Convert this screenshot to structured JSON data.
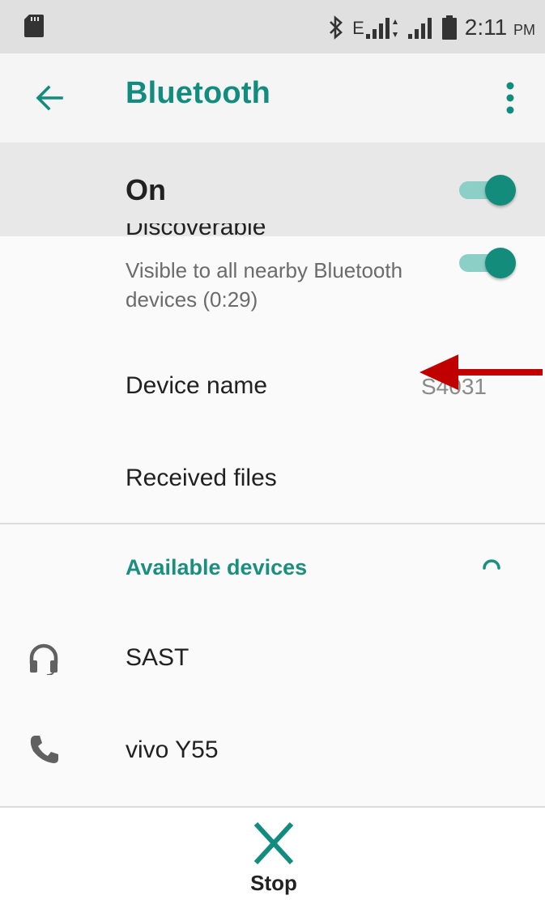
{
  "status_bar": {
    "network_type": "E",
    "time": "2:11",
    "time_suffix": "PM"
  },
  "app_bar": {
    "title": "Bluetooth"
  },
  "bluetooth_switch": {
    "label": "On",
    "enabled": true
  },
  "discoverable": {
    "title": "Discoverable",
    "subtitle": "Visible to all nearby Bluetooth devices (0:29)",
    "enabled": true
  },
  "device_name": {
    "label": "Device name",
    "value": "S4031"
  },
  "received_files": {
    "label": "Received files"
  },
  "available_devices": {
    "header": "Available devices",
    "devices": [
      {
        "name": "SAST",
        "icon": "headphones-icon"
      },
      {
        "name": "vivo Y55",
        "icon": "phone-icon"
      }
    ]
  },
  "bottom_action": {
    "label": "Stop",
    "icon": "close-x-icon"
  },
  "colors": {
    "accent": "#128c7e",
    "annotation_arrow": "#c00000"
  }
}
